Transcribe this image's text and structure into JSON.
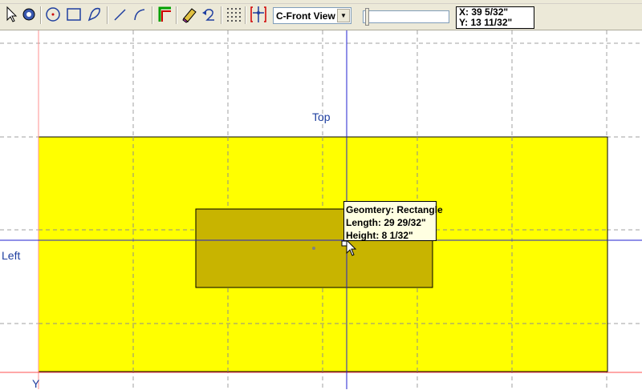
{
  "toolbar": {
    "view_select": {
      "value": "C-Front View"
    },
    "coords": {
      "x": "X: 39 5/32\"",
      "y": "Y: 13 11/32\""
    }
  },
  "canvas": {
    "label_top": "Top",
    "label_left": "Left",
    "label_y": "Y",
    "tooltip": {
      "line1": "Geomtery: Rectangle",
      "line2": "Length: 29 29/32\"",
      "line3": "Height: 8 1/32\""
    }
  },
  "colors": {
    "panel_fill": "#ffff00",
    "part_fill": "#c8b400",
    "axis_color": "#2020d0",
    "tooltip_bg": "#ffffe1"
  }
}
